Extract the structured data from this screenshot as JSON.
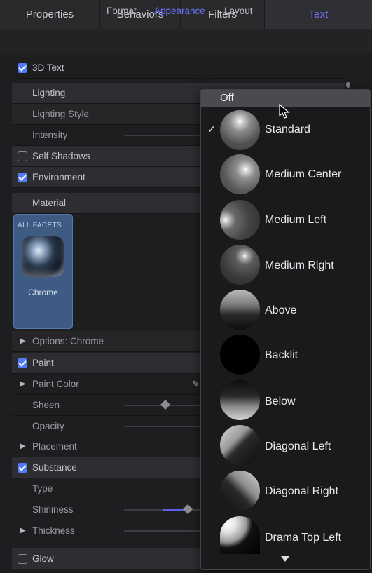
{
  "tabs": {
    "items": [
      {
        "label": "Properties",
        "active": false
      },
      {
        "label": "Behaviors",
        "active": false
      },
      {
        "label": "Filters",
        "active": false
      },
      {
        "label": "Text",
        "active": true
      }
    ]
  },
  "subtabs": {
    "format": "Format",
    "appearance": "Appearance",
    "layout": "Layout",
    "active": "Appearance"
  },
  "inspector": {
    "text3d": {
      "label": "3D Text",
      "checked": true
    },
    "lighting": "Lighting",
    "lighting_style": "Lighting Style",
    "intensity": "Intensity",
    "self_shadows": {
      "label": "Self Shadows",
      "checked": false
    },
    "environment": {
      "label": "Environment",
      "checked": true
    },
    "material": "Material",
    "material_tile": {
      "facets_label": "ALL FACETS",
      "name": "Chrome"
    },
    "options": "Options: Chrome",
    "paint": {
      "label": "Paint",
      "checked": true
    },
    "paint_color": "Paint Color",
    "sheen": "Sheen",
    "opacity": "Opacity",
    "placement": "Placement",
    "substance": {
      "label": "Substance",
      "checked": true
    },
    "type": "Type",
    "shininess": "Shininess",
    "thickness": "Thickness",
    "glow": {
      "label": "Glow",
      "checked": false
    }
  },
  "lighting_menu": {
    "off_label": "Off",
    "selected": "Standard",
    "items": [
      "Standard",
      "Medium Center",
      "Medium Left",
      "Medium Right",
      "Above",
      "Backlit",
      "Below",
      "Diagonal Left",
      "Diagonal Right",
      "Drama Top Left"
    ]
  },
  "colors": {
    "accent": "#6b73ff",
    "checkbox_blue": "#4f7cf7",
    "tile_blue": "#3e5b83"
  },
  "icons": [
    "checkmark-icon",
    "disclosure-triangle-icon",
    "eyedropper-icon",
    "chevron-down-icon",
    "mouse-pointer-icon"
  ]
}
